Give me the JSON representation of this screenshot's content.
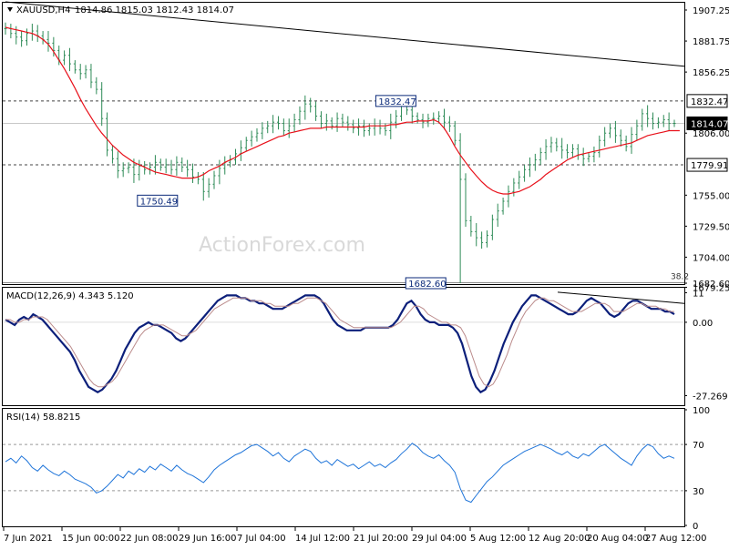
{
  "header": {
    "symbol": "XAUUSD,H4",
    "ohlc": "1814.86 1815.03 1812.43 1814.07"
  },
  "watermark": "ActionForex.com",
  "colors": {
    "candle": "#2e8b57",
    "sma": "#e8101a",
    "macd_line": "#0c1f7a",
    "macd_signal": "#bb8b8b",
    "rsi": "#1e74d9",
    "grid_dash": "#444444",
    "frame": "#000000"
  },
  "chart_data": [
    {
      "type": "candlestick",
      "panel": "price",
      "ylim": [
        1682.6,
        1912.5
      ],
      "y_ticks": [
        "1907.25",
        "1881.75",
        "1856.25",
        "1832.47",
        "1814.07",
        "1806.00",
        "1779.91",
        "1755.00",
        "1729.50",
        "1704.00",
        "1682.60",
        "1679.25"
      ],
      "horizontal_lines": [
        {
          "label": "1832.47",
          "value": 1832.47
        },
        {
          "label": "1779.91",
          "value": 1779.91
        }
      ],
      "last_price_label": "1814.07",
      "annotations": [
        {
          "text": "1832.47",
          "x_index": 75,
          "value": 1832.47
        },
        {
          "text": "1750.49",
          "x_index": 25,
          "value": 1750.49
        },
        {
          "text": "1682.60",
          "x_index": 84,
          "value": 1682.6
        }
      ],
      "fib_label": "38.2",
      "trendline": [
        {
          "x_index": 0,
          "value": 1914
        },
        {
          "x_index": 139,
          "value": 1861
        }
      ],
      "closes": [
        1892,
        1888,
        1885,
        1882,
        1888,
        1890,
        1886,
        1883,
        1880,
        1874,
        1866,
        1870,
        1863,
        1858,
        1855,
        1858,
        1848,
        1842,
        1818,
        1792,
        1785,
        1775,
        1777,
        1778,
        1772,
        1779,
        1776,
        1778,
        1782,
        1778,
        1780,
        1776,
        1782,
        1778,
        1776,
        1770,
        1768,
        1758,
        1764,
        1771,
        1777,
        1782,
        1784,
        1789,
        1794,
        1800,
        1803,
        1806,
        1810,
        1812,
        1815,
        1814,
        1808,
        1812,
        1817,
        1824,
        1830,
        1828,
        1820,
        1814,
        1816,
        1812,
        1818,
        1815,
        1813,
        1810,
        1812,
        1808,
        1810,
        1812,
        1810,
        1808,
        1815,
        1820,
        1830,
        1825,
        1820,
        1817,
        1815,
        1818,
        1818,
        1820,
        1815,
        1812,
        1800,
        1768,
        1734,
        1725,
        1720,
        1716,
        1722,
        1735,
        1742,
        1750,
        1758,
        1765,
        1770,
        1776,
        1780,
        1784,
        1790,
        1795,
        1798,
        1795,
        1792,
        1790,
        1793,
        1788,
        1785,
        1787,
        1790,
        1800,
        1806,
        1810,
        1804,
        1800,
        1795,
        1805,
        1812,
        1822,
        1818,
        1814,
        1815,
        1817,
        1814,
        1814
      ],
      "sma": [
        1893,
        1892,
        1891,
        1890,
        1889,
        1888,
        1886,
        1883,
        1879,
        1873,
        1866,
        1859,
        1851,
        1843,
        1834,
        1826,
        1819,
        1812,
        1806,
        1801,
        1796,
        1792,
        1788,
        1785,
        1782,
        1780,
        1778,
        1776,
        1774,
        1773,
        1772,
        1771,
        1770,
        1769,
        1769,
        1769,
        1770,
        1772,
        1775,
        1777,
        1779,
        1782,
        1784,
        1786,
        1789,
        1791,
        1793,
        1795,
        1797,
        1799,
        1801,
        1803,
        1804,
        1806,
        1807,
        1808,
        1809,
        1810,
        1810,
        1810,
        1811,
        1811,
        1811,
        1811,
        1811,
        1811,
        1811,
        1811,
        1812,
        1812,
        1812,
        1812,
        1813,
        1813,
        1814,
        1815,
        1815,
        1816,
        1816,
        1816,
        1817,
        1815,
        1810,
        1803,
        1795,
        1788,
        1782,
        1776,
        1771,
        1766,
        1762,
        1759,
        1757,
        1756,
        1756,
        1757,
        1758,
        1760,
        1762,
        1765,
        1768,
        1772,
        1775,
        1778,
        1781,
        1784,
        1786,
        1788,
        1789,
        1790,
        1791,
        1792,
        1793,
        1794,
        1795,
        1796,
        1797,
        1798,
        1800,
        1802,
        1804,
        1805,
        1806,
        1807,
        1808,
        1808,
        1808
      ],
      "x_tick_labels": [
        "7 Jun 2021",
        "15 Jun 00:00",
        "22 Jun 08:00",
        "29 Jun 16:00",
        "7 Jul 04:00",
        "14 Jul 12:00",
        "21 Jul 20:00",
        "29 Jul 04:00",
        "5 Aug 12:00",
        "12 Aug 20:00",
        "20 Aug 04:00",
        "27 Aug 12:00"
      ]
    },
    {
      "type": "line",
      "panel": "macd",
      "label": "MACD(12,26,9) 4.343 5.120",
      "y_ticks": [
        "11",
        "0.00",
        "-27.269"
      ],
      "ylim": [
        -30.5,
        12.5
      ],
      "series": [
        {
          "role": "macd",
          "values": [
            1,
            0,
            -1,
            1,
            2,
            1,
            3,
            2,
            1,
            -1,
            -3,
            -5,
            -7,
            -9,
            -11,
            -14,
            -18,
            -21,
            -24,
            -25,
            -26,
            -25,
            -23,
            -21,
            -18,
            -14,
            -10,
            -7,
            -4,
            -2,
            -1,
            0,
            -1,
            -1,
            -2,
            -3,
            -4,
            -6,
            -7,
            -6,
            -4,
            -2,
            0,
            2,
            4,
            6,
            8,
            9,
            10,
            10,
            10,
            9,
            9,
            8,
            8,
            7,
            7,
            6,
            5,
            5,
            5,
            6,
            7,
            8,
            9,
            10,
            10,
            10,
            9,
            7,
            4,
            1,
            -1,
            -2,
            -3,
            -3,
            -3,
            -3,
            -2,
            -2,
            -2,
            -2,
            -2,
            -2,
            -1,
            1,
            4,
            7,
            8,
            6,
            3,
            1,
            0,
            0,
            -1,
            -1,
            -1,
            -2,
            -4,
            -8,
            -14,
            -20,
            -24,
            -26,
            -25,
            -22,
            -18,
            -13,
            -8,
            -4,
            0,
            3,
            6,
            8,
            10,
            10,
            9,
            8,
            7,
            6,
            5,
            4,
            3,
            3,
            4,
            6,
            8,
            9,
            8,
            7,
            5,
            3,
            2,
            3,
            5,
            7,
            8,
            8,
            7,
            6,
            5,
            5,
            5,
            4,
            4,
            3
          ]
        },
        {
          "role": "signal",
          "values": [
            1,
            1,
            0,
            0,
            1,
            1,
            2,
            2,
            2,
            1,
            -1,
            -3,
            -5,
            -7,
            -9,
            -12,
            -15,
            -18,
            -21,
            -23,
            -24,
            -24,
            -23,
            -22,
            -20,
            -17,
            -14,
            -11,
            -8,
            -5,
            -3,
            -2,
            -1,
            -1,
            -1,
            -2,
            -3,
            -4,
            -5,
            -5,
            -4,
            -3,
            -1,
            1,
            3,
            5,
            6,
            7,
            8,
            9,
            9,
            9,
            9,
            8,
            8,
            8,
            7,
            7,
            6,
            6,
            6,
            6,
            7,
            7,
            8,
            9,
            9,
            9,
            8,
            7,
            5,
            3,
            1,
            0,
            -1,
            -2,
            -2,
            -2,
            -2,
            -2,
            -2,
            -2,
            -2,
            -2,
            -1,
            0,
            2,
            4,
            6,
            6,
            5,
            3,
            2,
            1,
            0,
            0,
            -1,
            -1,
            -2,
            -5,
            -10,
            -15,
            -20,
            -23,
            -24,
            -23,
            -20,
            -16,
            -12,
            -7,
            -3,
            1,
            4,
            6,
            8,
            9,
            9,
            8,
            8,
            7,
            6,
            5,
            4,
            4,
            4,
            5,
            6,
            7,
            7,
            7,
            6,
            4,
            4,
            4,
            5,
            6,
            7,
            7,
            6,
            6,
            6,
            5,
            5,
            4,
            4
          ]
        }
      ]
    },
    {
      "type": "line",
      "panel": "rsi",
      "label": "RSI(14) 58.8215",
      "y_ticks": [
        "100",
        "70",
        "30",
        "0"
      ],
      "ylim": [
        0,
        100
      ],
      "levels": [
        70,
        30
      ],
      "series": [
        {
          "role": "rsi",
          "values": [
            55,
            58,
            54,
            60,
            56,
            50,
            47,
            52,
            48,
            45,
            43,
            47,
            44,
            40,
            38,
            36,
            33,
            28,
            30,
            34,
            39,
            44,
            41,
            47,
            44,
            49,
            46,
            51,
            48,
            53,
            50,
            47,
            52,
            48,
            45,
            43,
            40,
            37,
            42,
            48,
            52,
            55,
            58,
            61,
            63,
            66,
            69,
            70,
            67,
            64,
            60,
            63,
            58,
            55,
            60,
            63,
            66,
            64,
            58,
            54,
            56,
            52,
            57,
            54,
            51,
            53,
            49,
            52,
            55,
            51,
            53,
            50,
            54,
            57,
            62,
            66,
            71,
            68,
            63,
            60,
            58,
            61,
            56,
            52,
            46,
            32,
            22,
            20,
            26,
            32,
            38,
            42,
            47,
            52,
            55,
            58,
            61,
            64,
            66,
            68,
            70,
            68,
            66,
            63,
            61,
            64,
            60,
            58,
            62,
            60,
            64,
            68,
            70,
            66,
            62,
            58,
            55,
            52,
            60,
            66,
            70,
            68,
            62,
            58,
            60,
            58
          ]
        }
      ]
    }
  ]
}
